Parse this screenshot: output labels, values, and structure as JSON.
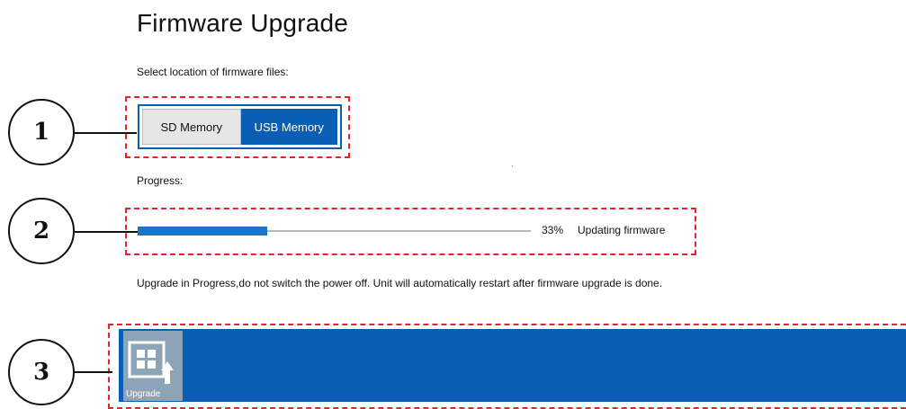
{
  "page": {
    "title": "Firmware Upgrade",
    "location_label": "Select location of firmware files:",
    "progress_label": "Progress:",
    "warning": "Upgrade in Progress,do not switch the power off. Unit will automatically restart after firmware upgrade is done."
  },
  "location_toggle": {
    "options": [
      "SD Memory",
      "USB Memory"
    ],
    "selected": "USB Memory"
  },
  "progress": {
    "percent_text": "33%",
    "value": 0.33,
    "status": "Updating firmware"
  },
  "toolbar": {
    "upgrade_label": "Upgrade",
    "upgrade_icon": "upgrade-icon"
  },
  "callouts": [
    "1",
    "2",
    "3"
  ],
  "colors": {
    "accent": "#0a5fb4",
    "progress_fill": "#1a76c2",
    "callout_dash": "#e8212a",
    "upgrade_button": "#8da3b7"
  }
}
